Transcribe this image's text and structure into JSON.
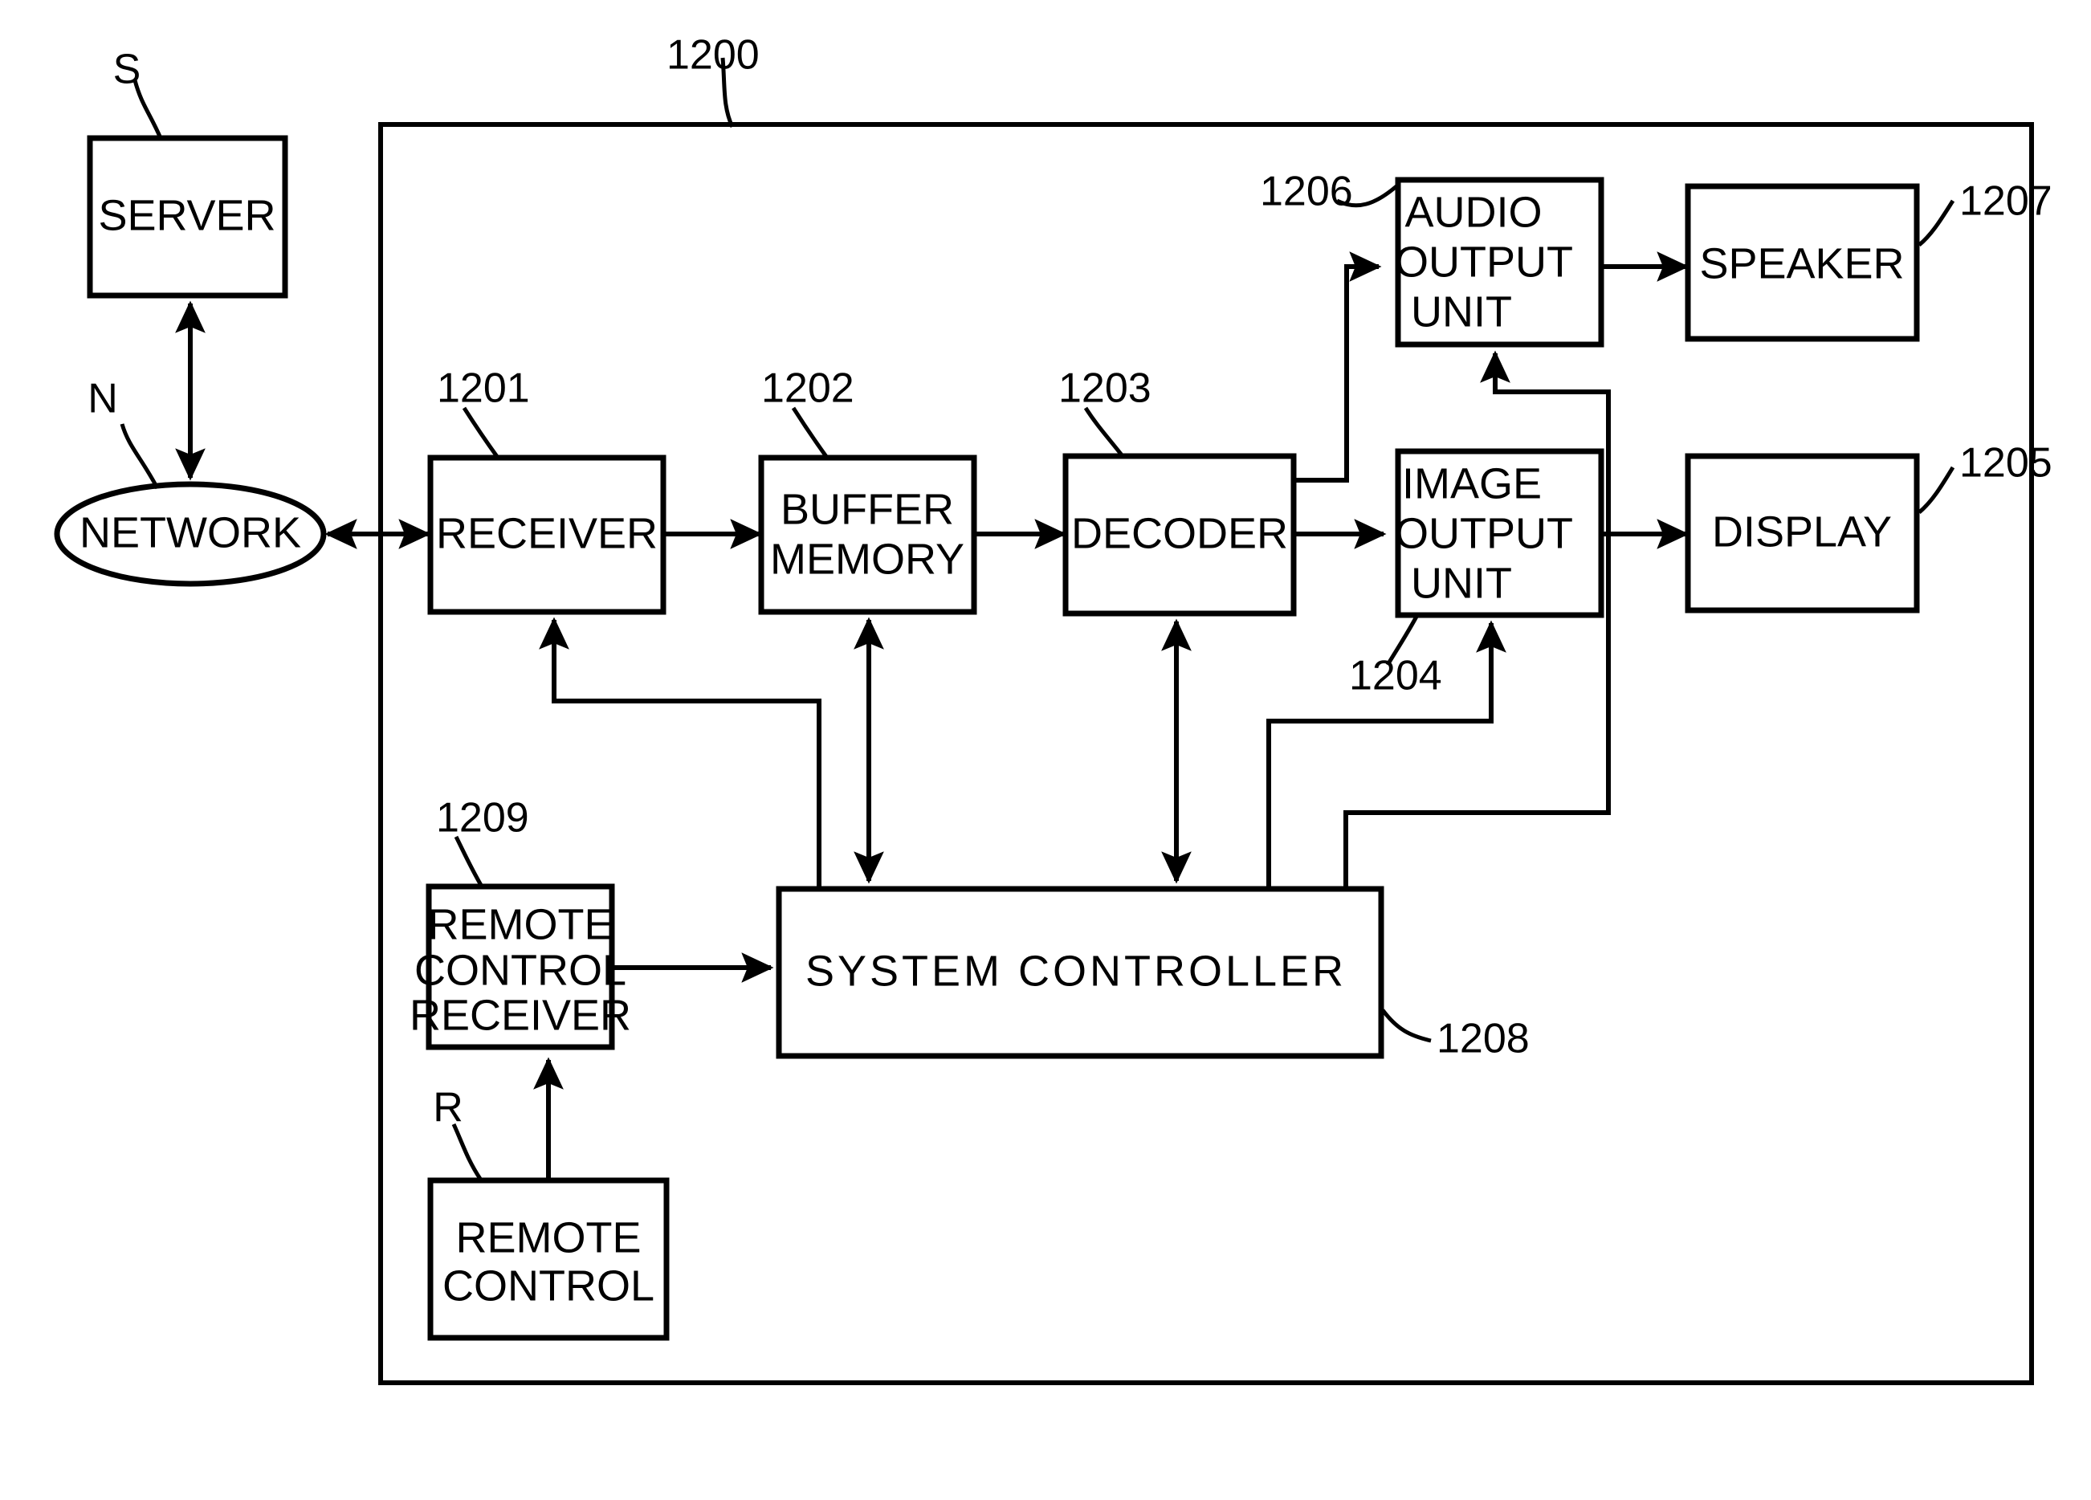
{
  "figure": {
    "type": "patent-block-diagram",
    "outer_enclosure_ref": "1200"
  },
  "blocks": {
    "server": {
      "label": "SERVER",
      "ref": "S"
    },
    "network": {
      "label": "NETWORK",
      "ref": "N"
    },
    "receiver": {
      "label": "RECEIVER",
      "ref": "1201"
    },
    "buffer_memory": {
      "line1": "BUFFER",
      "line2": "MEMORY",
      "ref": "1202"
    },
    "decoder": {
      "label": "DECODER",
      "ref": "1203"
    },
    "image_output_unit": {
      "line1": "IMAGE",
      "line2": "OUTPUT",
      "line3": "UNIT",
      "ref": "1204"
    },
    "display": {
      "label": "DISPLAY",
      "ref": "1205"
    },
    "audio_output_unit": {
      "line1": "AUDIO",
      "line2": "OUTPUT",
      "line3": "UNIT",
      "ref": "1206"
    },
    "speaker": {
      "label": "SPEAKER",
      "ref": "1207"
    },
    "system_controller": {
      "label": "SYSTEM  CONTROLLER",
      "ref": "1208"
    },
    "remote_control_receiver": {
      "line1": "REMOTE",
      "line2": "CONTROL",
      "line3": "RECEIVER",
      "ref": "1209"
    },
    "remote_control": {
      "line1": "REMOTE",
      "line2": "CONTROL",
      "ref": "R"
    }
  },
  "enclosure": {
    "ref": "1200"
  },
  "colors": {
    "ink": "#000000",
    "paper": "#ffffff"
  }
}
